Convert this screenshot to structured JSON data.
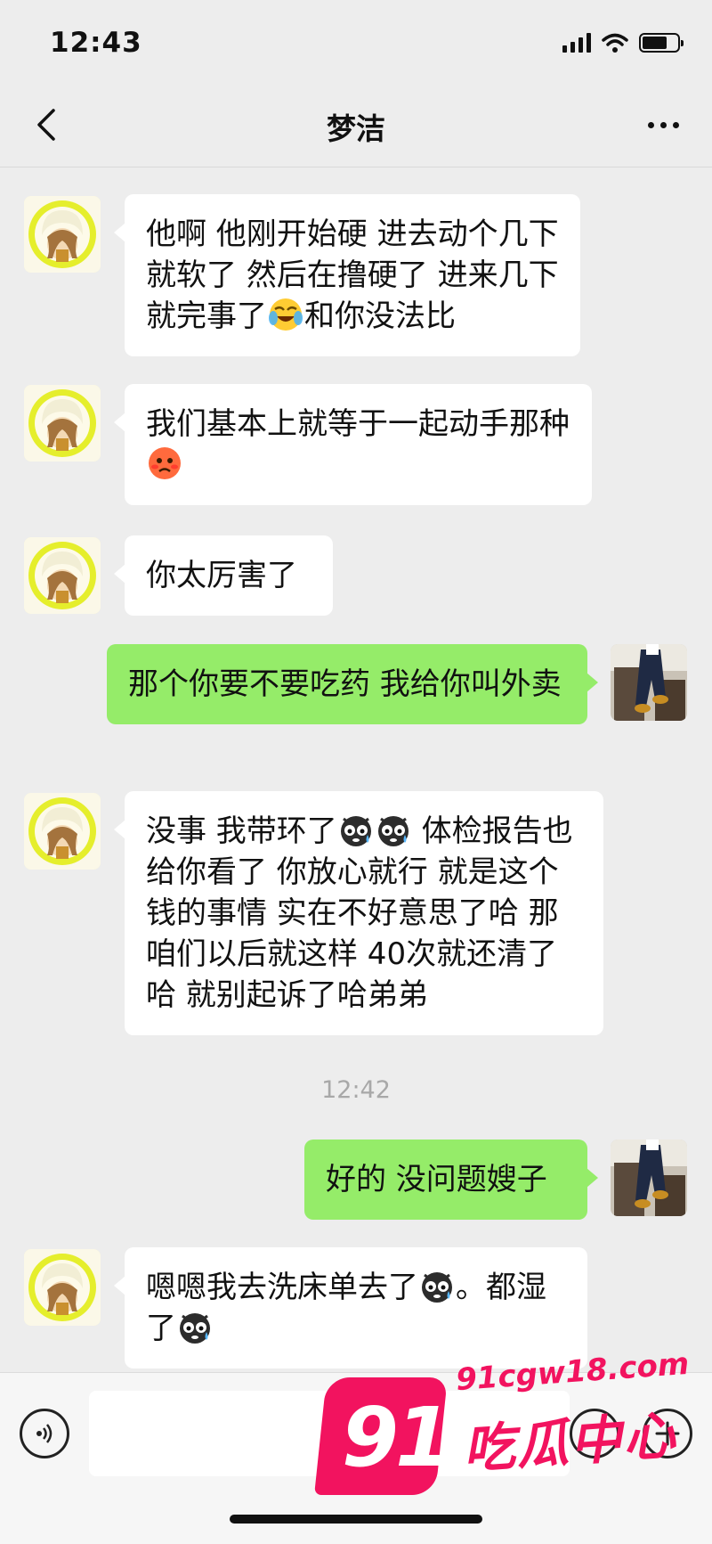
{
  "status_bar": {
    "time": "12:43",
    "battery_level": 0.7
  },
  "nav": {
    "title": "梦洁"
  },
  "messages": [
    {
      "side": "left",
      "parts": [
        "他啊 他刚开始硬 进去动个几下就软了 然后在撸硬了 进来几下就完事了",
        "和你没法比"
      ],
      "emojis": [
        "laugh-cry-emoji"
      ]
    },
    {
      "side": "left",
      "parts": [
        "我们基本上就等于一起动手那种"
      ],
      "emojis": [
        "blush-emoji"
      ]
    },
    {
      "side": "left",
      "parts": [
        "你太厉害了"
      ]
    },
    {
      "side": "right",
      "parts": [
        "那个你要不要吃药 我给你叫外卖"
      ]
    },
    {
      "side": "left",
      "parts": [
        "没事 我带环了",
        " 体检报告也给你看了 你放心就行 就是这个钱的事情 实在不好意思了哈 那咱们以后就这样 40次就还清了哈 就别起诉了哈弟弟"
      ],
      "emojis": [
        "sweat-emoji",
        "sweat-emoji"
      ]
    },
    {
      "side": "right",
      "parts": [
        "好的 没问题嫂子"
      ]
    },
    {
      "side": "left",
      "parts": [
        " 嗯嗯我去洗床单去了",
        "。都湿了"
      ],
      "emojis": [
        "sweat-emoji",
        "sweat-emoji"
      ]
    }
  ],
  "time_separator": "12:42",
  "input": {
    "value": ""
  },
  "watermark": {
    "number": "91",
    "url": "91cgw18.com",
    "name": "吃瓜中心"
  },
  "colors": {
    "background": "#ededed",
    "bubble_left": "#ffffff",
    "bubble_right": "#95ec69",
    "watermark": "#f2135f"
  }
}
